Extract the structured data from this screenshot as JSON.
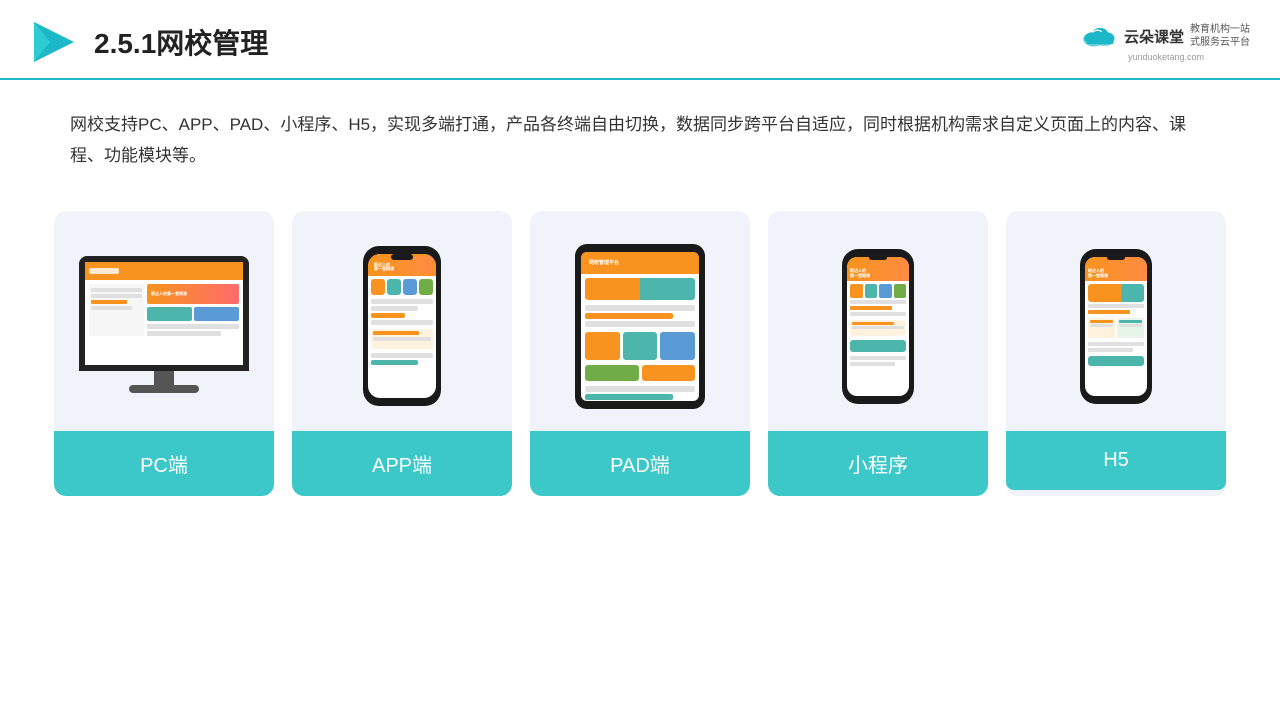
{
  "header": {
    "title": "2.5.1网校管理",
    "logo_name": "云朵课堂",
    "logo_url": "yunduoketang.com",
    "logo_tagline": "教育机构一站\n式服务云平台"
  },
  "description": {
    "text": "网校支持PC、APP、PAD、小程序、H5，实现多端打通，产品各终端自由切换，数据同步跨平台自适应，同时根据机构需求自定义页面上的内容、课程、功能模块等。"
  },
  "cards": [
    {
      "id": "pc",
      "label": "PC端"
    },
    {
      "id": "app",
      "label": "APP端"
    },
    {
      "id": "pad",
      "label": "PAD端"
    },
    {
      "id": "miniprogram",
      "label": "小程序"
    },
    {
      "id": "h5",
      "label": "H5"
    }
  ],
  "colors": {
    "teal": "#3cc8c8",
    "accent": "#1cb8c8",
    "card_bg": "#eef2f8"
  }
}
